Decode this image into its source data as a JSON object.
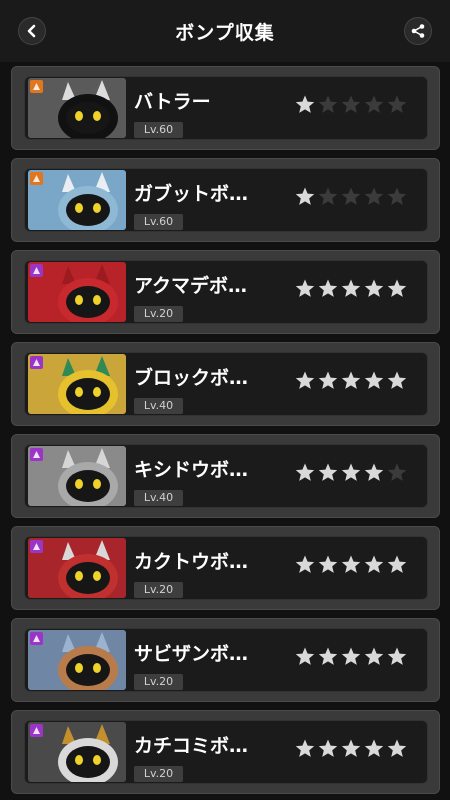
{
  "header": {
    "title": "ボンプ収集",
    "back_icon": "back-arrow-icon",
    "share_icon": "share-icon"
  },
  "colors": {
    "star_on": "#d9d9d9",
    "star_off": "#3b3b3b",
    "badge_s": "#e0761e",
    "badge_a": "#9a35c8"
  },
  "bangboos": [
    {
      "name": "バトラー",
      "level": "Lv.60",
      "rank": "S",
      "stars": 1,
      "max_stars": 5
    },
    {
      "name": "ガブットボ…",
      "level": "Lv.60",
      "rank": "S",
      "stars": 1,
      "max_stars": 5
    },
    {
      "name": "アクマデボ…",
      "level": "Lv.20",
      "rank": "A",
      "stars": 5,
      "max_stars": 5
    },
    {
      "name": "ブロックボ…",
      "level": "Lv.40",
      "rank": "A",
      "stars": 5,
      "max_stars": 5
    },
    {
      "name": "キシドウボ…",
      "level": "Lv.40",
      "rank": "A",
      "stars": 4,
      "max_stars": 5
    },
    {
      "name": "カクトウボ…",
      "level": "Lv.20",
      "rank": "A",
      "stars": 5,
      "max_stars": 5
    },
    {
      "name": "サビザンボ…",
      "level": "Lv.20",
      "rank": "A",
      "stars": 5,
      "max_stars": 5
    },
    {
      "name": "カチコミボ…",
      "level": "Lv.20",
      "rank": "A",
      "stars": 5,
      "max_stars": 5
    }
  ]
}
